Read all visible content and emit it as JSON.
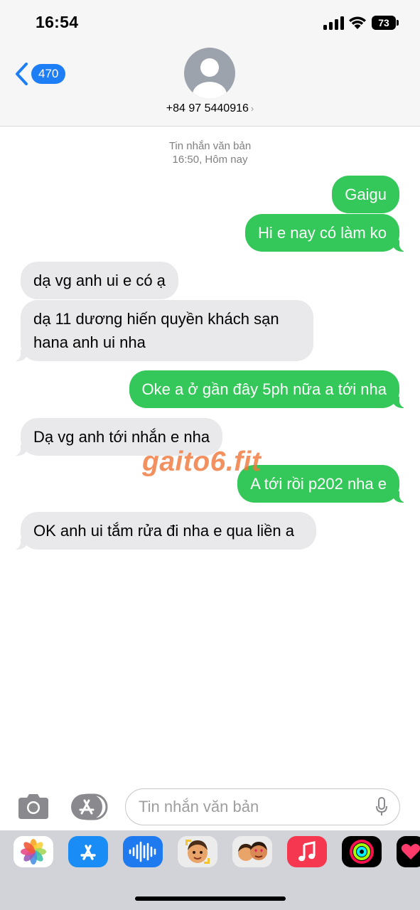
{
  "status_bar": {
    "time": "16:54",
    "battery": "73"
  },
  "header": {
    "back_count": "470",
    "contact_number": "+84 97 5440916"
  },
  "conversation": {
    "meta_line1": "Tin nhắn văn bản",
    "meta_line2": "16:50, Hôm nay",
    "messages": [
      {
        "from": "me",
        "text": "Gaigu"
      },
      {
        "from": "me",
        "text": "Hi e nay có làm ko"
      },
      {
        "from": "them",
        "text": "dạ vg anh ui e có ạ"
      },
      {
        "from": "them",
        "text": "dạ 11 dương hiến quyền khách sạn hana anh ui nha"
      },
      {
        "from": "me",
        "text": "Oke a ở gần đây 5ph nữa a tới nha"
      },
      {
        "from": "them",
        "text": "Dạ vg anh tới nhắn e nha"
      },
      {
        "from": "me",
        "text": "A tới rồi p202 nha e"
      },
      {
        "from": "them",
        "text": "OK anh ui tắm rửa đi nha e qua liền a"
      }
    ]
  },
  "watermark": "gaito6.fit",
  "input_bar": {
    "placeholder": "Tin nhắn văn bản"
  },
  "app_drawer": [
    "photos-icon",
    "app-store-icon",
    "audio-message-icon",
    "memoji-icon",
    "animoji-icon",
    "music-icon",
    "activity-icon",
    "digital-touch-icon"
  ],
  "colors": {
    "sent": "#34c759",
    "received": "#e9e9eb",
    "accent": "#1e7ef5"
  }
}
